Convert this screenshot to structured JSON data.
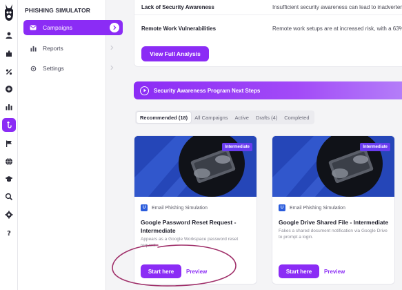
{
  "sidebar": {
    "title": "PHISHING SIMULATOR",
    "items": [
      {
        "label": "Campaigns",
        "icon": "mail-icon"
      },
      {
        "label": "Reports",
        "icon": "bar-chart-icon"
      },
      {
        "label": "Settings",
        "icon": "gear-icon"
      }
    ]
  },
  "rail": {
    "icons": [
      "llama-logo",
      "user-icon",
      "puzzle-icon",
      "percent-icon",
      "plus-circle-icon",
      "bar-chart-icon",
      "phishing-hook-icon",
      "flag-icon",
      "globe-icon",
      "graduation-icon",
      "search-icon",
      "gear-icon",
      "help-icon"
    ]
  },
  "analysis": {
    "rows": [
      {
        "name": "Lack of Security Awareness",
        "desc": "Insufficient security awareness can lead to inadverten"
      },
      {
        "name": "Remote Work Vulnerabilities",
        "desc": "Remote work setups are at increased risk, with a 63%"
      }
    ],
    "button_label": "View Full Analysis"
  },
  "banner": {
    "label": "Security Awareness Program Next Steps"
  },
  "tabs": [
    {
      "label": "Recommended (18)",
      "active": true
    },
    {
      "label": "All Campaigns",
      "active": false
    },
    {
      "label": "Active",
      "active": false
    },
    {
      "label": "Drafts (4)",
      "active": false
    },
    {
      "label": "Completed",
      "active": false
    }
  ],
  "cards": [
    {
      "badge": "Intermediate",
      "type_icon": "U",
      "type": "Email Phishing Simulation",
      "title": "Google Password Reset Request - Intermediate",
      "desc": "Appears as a Google Workspace password reset request.",
      "start_label": "Start here",
      "preview_label": "Preview"
    },
    {
      "badge": "Intermediate",
      "type_icon": "U",
      "type": "Email Phishing Simulation",
      "title": "Google Drive Shared File - Intermediate",
      "desc": "Fakes a shared document notification via Google Drive to prompt a login.",
      "start_label": "Start here",
      "preview_label": "Preview"
    }
  ],
  "colors": {
    "accent": "#8b2cf5",
    "annotation": "#a0306a"
  }
}
